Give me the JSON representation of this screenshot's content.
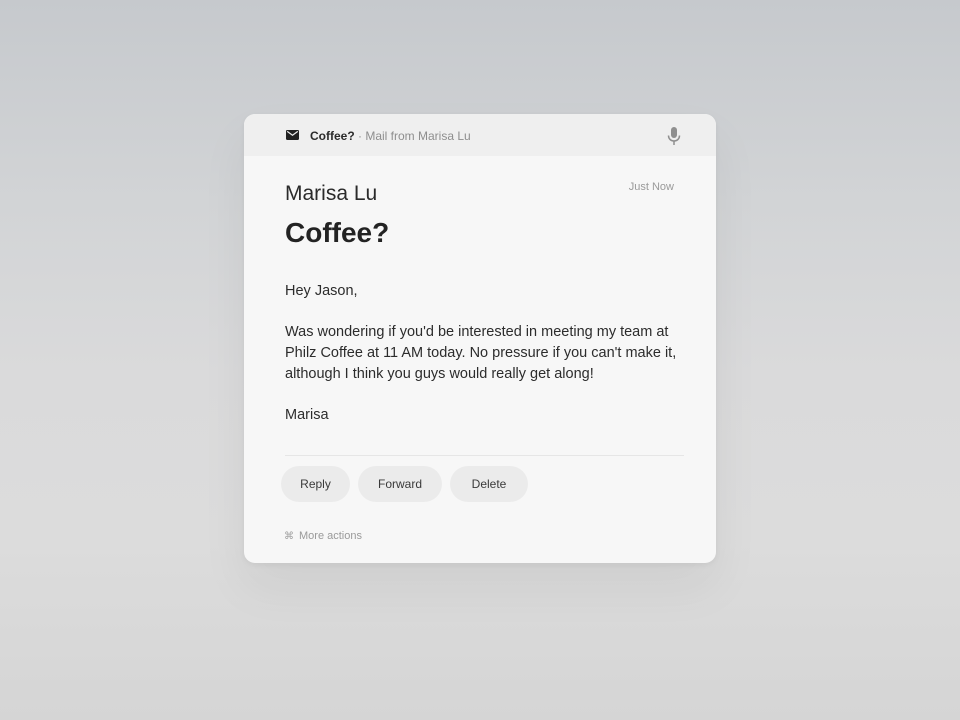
{
  "header": {
    "icon": "mail-icon",
    "subject": "Coffee?",
    "separator": " · ",
    "source": "Mail from Marisa Lu",
    "voice_icon": "microphone-icon"
  },
  "message": {
    "sender": "Marisa Lu",
    "time": "Just Now",
    "subject": "Coffee?",
    "greeting": "Hey Jason,",
    "body": "Was wondering if you'd be interested in meeting my team at Philz Coffee at 11 AM today. No pressure if you can't make it, although I think you guys would really get along!",
    "signature": "Marisa"
  },
  "actions": {
    "reply": "Reply",
    "forward": "Forward",
    "delete": "Delete"
  },
  "footer": {
    "shortcut_symbol": "⌘",
    "more_actions": "More actions"
  }
}
